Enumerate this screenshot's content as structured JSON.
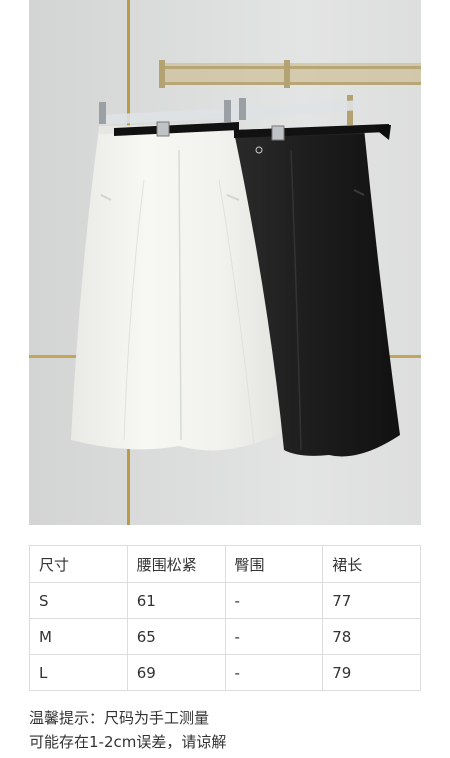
{
  "photo": {
    "subject": "white and black A-line midi skirts with belts on hangers"
  },
  "size_table": {
    "headers": [
      "尺寸",
      "腰围松紧",
      "臀围",
      "裙长"
    ],
    "rows": [
      [
        "S",
        "61",
        "-",
        "77"
      ],
      [
        "M",
        "65",
        "-",
        "78"
      ],
      [
        "L",
        "69",
        "-",
        "79"
      ]
    ]
  },
  "note": {
    "line1": "温馨提示：尺码为手工测量",
    "line2": "可能存在1-2cm误差，请谅解"
  },
  "colors": {
    "text": "#333333",
    "table_border": "#dddddd",
    "white_skirt": "#f4f5f1",
    "black_skirt": "#1f1f1f"
  }
}
